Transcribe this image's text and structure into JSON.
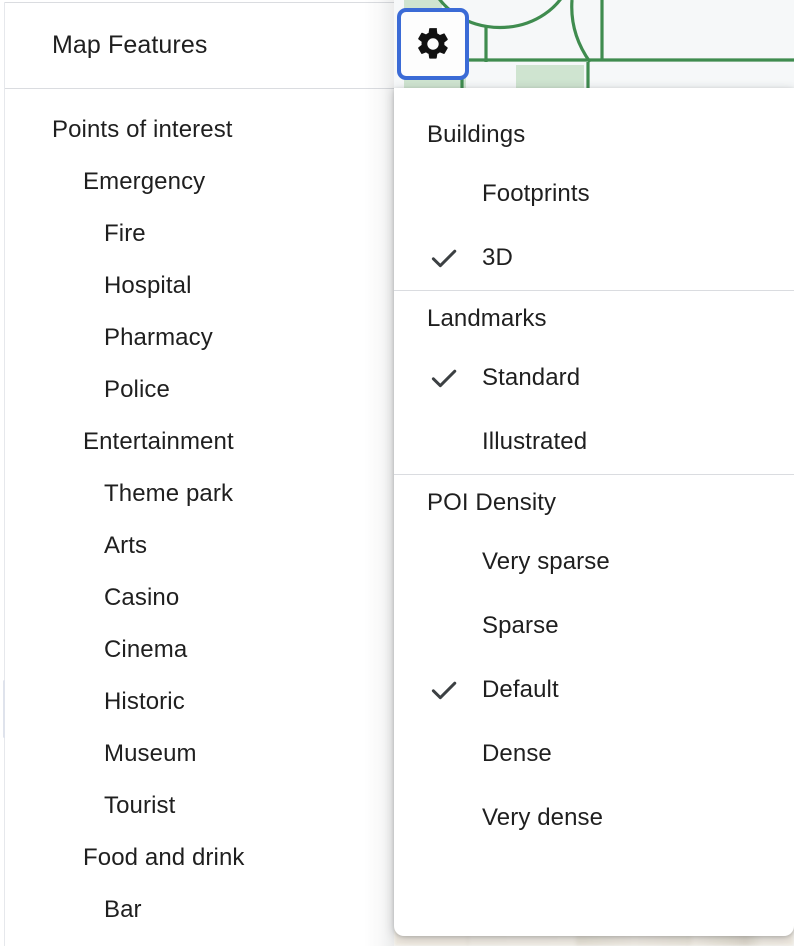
{
  "panel": {
    "title": "Map Features",
    "items": [
      {
        "label": "Points of interest",
        "level": 0
      },
      {
        "label": "Emergency",
        "level": 1
      },
      {
        "label": "Fire",
        "level": 2
      },
      {
        "label": "Hospital",
        "level": 2
      },
      {
        "label": "Pharmacy",
        "level": 2
      },
      {
        "label": "Police",
        "level": 2
      },
      {
        "label": "Entertainment",
        "level": 1
      },
      {
        "label": "Theme park",
        "level": 2
      },
      {
        "label": "Arts",
        "level": 2
      },
      {
        "label": "Casino",
        "level": 2
      },
      {
        "label": "Cinema",
        "level": 2
      },
      {
        "label": "Historic",
        "level": 2
      },
      {
        "label": "Museum",
        "level": 2
      },
      {
        "label": "Tourist",
        "level": 2
      },
      {
        "label": "Food and drink",
        "level": 1
      },
      {
        "label": "Bar",
        "level": 2
      }
    ]
  },
  "toolbar": {
    "settings_icon": "gear-icon",
    "settings_label": "Settings",
    "focus_ring_color": "#3b6bd6"
  },
  "menu": {
    "check_icon": "check-icon",
    "sections": [
      {
        "header": "Buildings",
        "items": [
          {
            "label": "Footprints",
            "checked": false
          },
          {
            "label": "3D",
            "checked": true
          }
        ]
      },
      {
        "header": "Landmarks",
        "items": [
          {
            "label": "Standard",
            "checked": true
          },
          {
            "label": "Illustrated",
            "checked": false
          }
        ]
      },
      {
        "header": "POI Density",
        "items": [
          {
            "label": "Very sparse",
            "checked": false
          },
          {
            "label": "Sparse",
            "checked": false
          },
          {
            "label": "Default",
            "checked": true
          },
          {
            "label": "Dense",
            "checked": false
          },
          {
            "label": "Very dense",
            "checked": false
          }
        ]
      }
    ]
  },
  "map": {
    "background_color": "#f6f8f9",
    "road_color": "#3f8c4f",
    "park_color": "#cfe4d0"
  }
}
